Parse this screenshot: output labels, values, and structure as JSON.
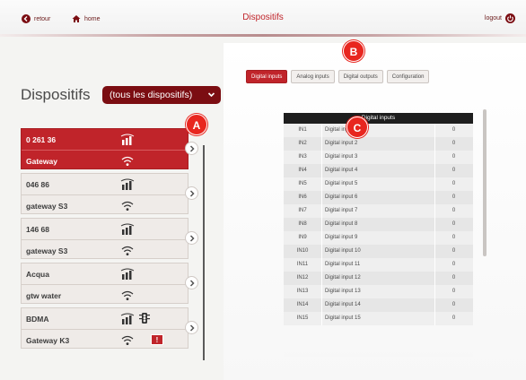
{
  "nav": {
    "back_label": "retour",
    "home_label": "home",
    "title": "Dispositifs",
    "logout_label": "logout"
  },
  "header": {
    "title": "Dispositifs",
    "filter_value": "(tous les dispositifs)"
  },
  "devices": [
    {
      "id": "0 261 36",
      "name": "Gateway",
      "active": true,
      "icons": [
        "signal-bars-icon"
      ],
      "alert": false
    },
    {
      "id": "046 86",
      "name": "gateway S3",
      "active": false,
      "icons": [
        "signal-bars-icon"
      ],
      "alert": false
    },
    {
      "id": "146 68",
      "name": "gateway S3",
      "active": false,
      "icons": [
        "signal-bars-icon"
      ],
      "alert": false
    },
    {
      "id": "Acqua",
      "name": "gtw water",
      "active": false,
      "icons": [
        "signal-bars-icon"
      ],
      "alert": false
    },
    {
      "id": "BDMA",
      "name": "Gateway K3",
      "active": false,
      "icons": [
        "signal-bars-icon",
        "traffic-light-icon"
      ],
      "alert": true,
      "alert_label": "!"
    }
  ],
  "tabs": [
    {
      "label": "Digital inputs",
      "active": true
    },
    {
      "label": "Analog inputs",
      "active": false
    },
    {
      "label": "Digital outputs",
      "active": false
    },
    {
      "label": "Configuration",
      "active": false
    }
  ],
  "table": {
    "header": "Digital inputs",
    "rows": [
      {
        "code": "IN1",
        "name": "Digital input 1",
        "value": "0"
      },
      {
        "code": "IN2",
        "name": "Digital input 2",
        "value": "0"
      },
      {
        "code": "IN3",
        "name": "Digital input 3",
        "value": "0"
      },
      {
        "code": "IN4",
        "name": "Digital input 4",
        "value": "0"
      },
      {
        "code": "IN5",
        "name": "Digital input 5",
        "value": "0"
      },
      {
        "code": "IN6",
        "name": "Digital input 6",
        "value": "0"
      },
      {
        "code": "IN7",
        "name": "Digital input 7",
        "value": "0"
      },
      {
        "code": "IN8",
        "name": "Digital input 8",
        "value": "0"
      },
      {
        "code": "IN9",
        "name": "Digital input 9",
        "value": "0"
      },
      {
        "code": "IN10",
        "name": "Digital input 10",
        "value": "0"
      },
      {
        "code": "IN11",
        "name": "Digital input 11",
        "value": "0"
      },
      {
        "code": "IN12",
        "name": "Digital input 12",
        "value": "0"
      },
      {
        "code": "IN13",
        "name": "Digital input 13",
        "value": "0"
      },
      {
        "code": "IN14",
        "name": "Digital input 14",
        "value": "0"
      },
      {
        "code": "IN15",
        "name": "Digital input 15",
        "value": "0"
      }
    ]
  },
  "callouts": {
    "a": "A",
    "b": "B",
    "c": "C"
  },
  "colors": {
    "accent": "#c0242a",
    "dark_red": "#7b0d12",
    "callout": "#e8261f"
  }
}
